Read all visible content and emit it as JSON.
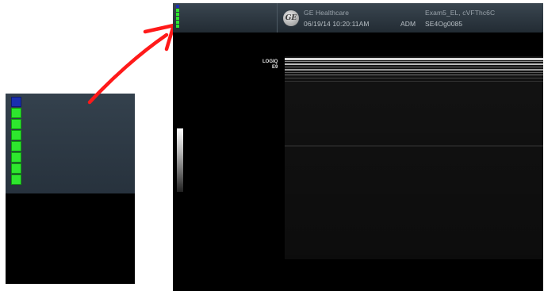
{
  "inset": {
    "leds": [
      "blue",
      "green",
      "green",
      "green",
      "green",
      "green",
      "green",
      "green"
    ]
  },
  "header": {
    "leds": [
      "blue",
      "green",
      "green",
      "green",
      "green",
      "green"
    ],
    "logo_text": "GE",
    "company": "GE Healthcare",
    "datetime": "06/19/14 10:20:11AM",
    "operator": "ADM",
    "exam": "Exam5_EL, cVFThc6C",
    "serial": "SE4Og0085"
  },
  "screen": {
    "device_label_line1": "LOGIQ",
    "device_label_line2": "E9"
  },
  "colors": {
    "arrow": "#ff1a1a",
    "led_green": "#2ee62e",
    "led_blue": "#1a2fb0",
    "header_bg": "#2c3640"
  }
}
